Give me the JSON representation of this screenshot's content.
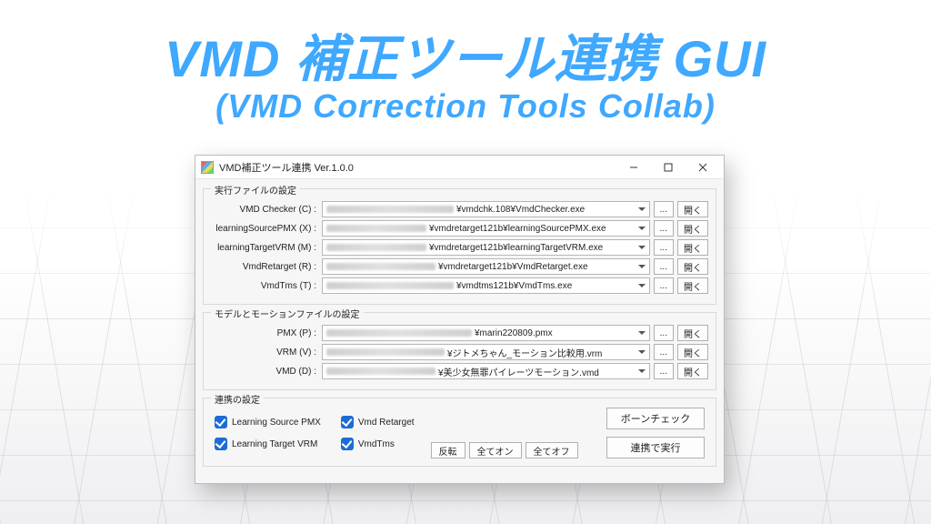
{
  "headline": "VMD 補正ツール連携 GUI",
  "subline": "(VMD Correction Tools Collab)",
  "window": {
    "title": "VMD補正ツール連携 Ver.1.0.0",
    "group1": {
      "title": "実行ファイルの設定",
      "rows": [
        {
          "label": "VMD Checker (C) :",
          "visible": "¥vmdchk.108¥VmdChecker.exe"
        },
        {
          "label": "learningSourcePMX (X) :",
          "visible": "¥vmdretarget121b¥learningSourcePMX.exe"
        },
        {
          "label": "learningTargetVRM (M) :",
          "visible": "¥vmdretarget121b¥learningTargetVRM.exe"
        },
        {
          "label": "VmdRetarget (R) :",
          "visible": "¥vmdretarget121b¥VmdRetarget.exe"
        },
        {
          "label": "VmdTms (T) :",
          "visible": "¥vmdtms121b¥VmdTms.exe"
        }
      ],
      "browse": "...",
      "open": "開く"
    },
    "group2": {
      "title": "モデルとモーションファイルの設定",
      "rows": [
        {
          "label": "PMX (P) :",
          "visible": "¥marin220809.pmx"
        },
        {
          "label": "VRM (V) :",
          "visible": "¥ジトメちゃん_モーション比較用.vrm"
        },
        {
          "label": "VMD (D) :",
          "visible": "¥美少女無罪パイレーツモーション.vmd"
        }
      ],
      "browse": "...",
      "open": "開く"
    },
    "group3": {
      "title": "連携の設定",
      "checks": {
        "c1": "Learning Source PMX",
        "c2": "Vmd Retarget",
        "c3": "Learning Target VRM",
        "c4": "VmdTms"
      },
      "invert": "反転",
      "allon": "全てオン",
      "alloff": "全てオフ",
      "bonecheck": "ボーンチェック",
      "run": "連携で実行"
    }
  }
}
